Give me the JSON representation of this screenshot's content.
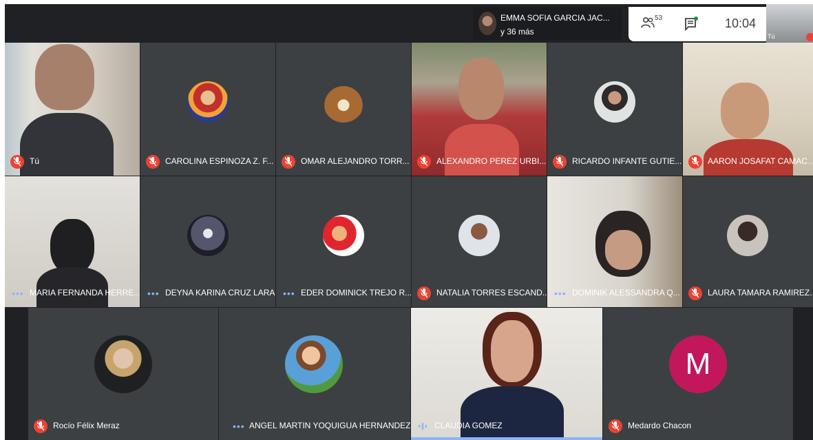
{
  "presenter": {
    "name": "EMMA SOFIA GARCIA JAC...",
    "more": "y 36 más"
  },
  "controls": {
    "participants_count": "53",
    "time": "10:04"
  },
  "self_thumb": {
    "label": "Tú"
  },
  "tiles": [
    {
      "name": "Tú",
      "status": "muted"
    },
    {
      "name": "CAROLINA ESPINOZA Z. F...",
      "status": "muted"
    },
    {
      "name": "OMAR ALEJANDRO TORR...",
      "status": "muted"
    },
    {
      "name": "ALEXANDRO PEREZ URBI...",
      "status": "muted"
    },
    {
      "name": "RICARDO INFANTE GUTIE...",
      "status": "muted"
    },
    {
      "name": "AARON JOSAFAT CAMAC...",
      "status": "muted"
    },
    {
      "name": "MARIA FERNANDA HERRE...",
      "status": "options"
    },
    {
      "name": "DEYNA KARINA CRUZ LARA",
      "status": "options"
    },
    {
      "name": "EDER DOMINICK TREJO R...",
      "status": "options"
    },
    {
      "name": "NATALIA TORRES ESCAND...",
      "status": "muted"
    },
    {
      "name": "DOMINIK ALESSANDRA Q...",
      "status": "options"
    },
    {
      "name": "LAURA TAMARA RAMIREZ...",
      "status": "muted"
    },
    {
      "name": "Rocío Félix Meraz",
      "status": "muted"
    },
    {
      "name": "ANGEL MARTIN YOQUIGUA HERNANDEZ",
      "status": "options"
    },
    {
      "name": "CLAUDIA GOMEZ",
      "status": "speaking"
    },
    {
      "name": "Medardo Chacon",
      "status": "muted",
      "initial": "M"
    }
  ],
  "colors": {
    "mic_off": "#ea4335",
    "speaking_bar": "#8ab4f8",
    "avatar_letter_bg": "#c2185b"
  }
}
